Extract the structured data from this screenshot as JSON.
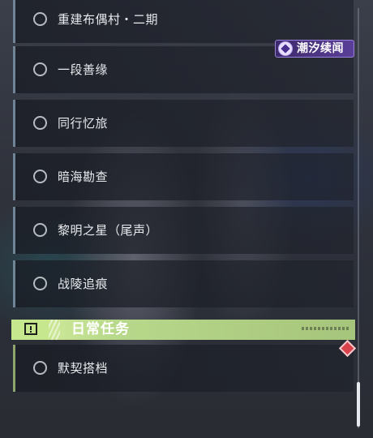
{
  "quest_list": {
    "items": [
      {
        "label": "重建布偶村・二期"
      },
      {
        "label": "一段善缘"
      },
      {
        "label": "同行忆旅"
      },
      {
        "label": "暗海勘查"
      },
      {
        "label": "黎明之星（尾声）"
      },
      {
        "label": "战陵追痕"
      }
    ]
  },
  "tag_badge": {
    "label": "潮汐续闻",
    "color": "#5a3f99"
  },
  "daily_section": {
    "title": "日常任务",
    "icon": "alert-box-icon",
    "color": "#c6e78d",
    "items": [
      {
        "label": "默契搭档"
      }
    ]
  },
  "alert_marker": {
    "icon": "red-diamond-icon",
    "color": "#d9424a"
  },
  "scrollbar": {
    "position": 0.9
  }
}
